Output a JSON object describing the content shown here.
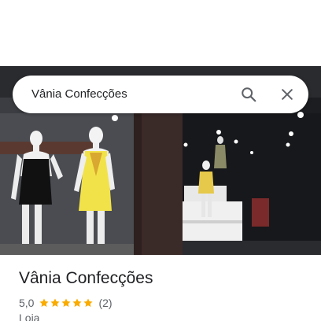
{
  "search": {
    "query": "Vânia Confecções"
  },
  "place": {
    "name": "Vânia Confecções",
    "rating": "5,0",
    "stars": 5,
    "review_count": "(2)",
    "category": "Loja"
  },
  "colors": {
    "star": "#f9ab00",
    "text_primary": "#202124",
    "text_secondary": "#5f6368",
    "icon": "#5f6368"
  },
  "icons": {
    "search": "search-icon",
    "close": "close-icon",
    "star": "star-icon"
  }
}
